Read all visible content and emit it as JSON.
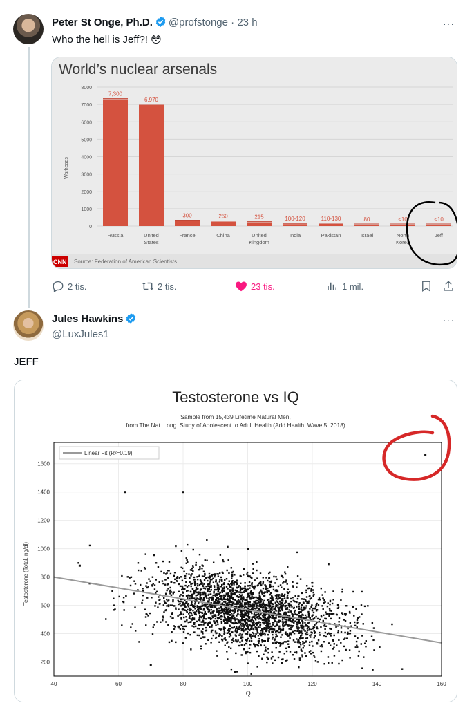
{
  "tweet1": {
    "author_name": "Peter St Onge, Ph.D.",
    "handle": "@profstonge",
    "separator": "·",
    "time": "23 h",
    "text": "Who the hell is Jeff?! 😳",
    "more_label": "···",
    "chart_image": {
      "title": "World’s nuclear arsenals",
      "ylabel": "Warheads",
      "source": "Source: Federation of American Scientists",
      "logo_text": "CNN",
      "annotation": "circle around Jeff"
    },
    "actions": {
      "replies": "2 tis.",
      "reposts": "2 tis.",
      "likes": "23 tis.",
      "views": "1 mil."
    }
  },
  "tweet2": {
    "author_name": "Jules Hawkins",
    "handle": "@LuxJules1",
    "text": "JEFF",
    "more_label": "···",
    "chart_image": {
      "title": "Testosterone vs IQ",
      "subtitle_line1": "Sample from 15,439 Lifetime Natural Men,",
      "subtitle_line2": "from The Nat. Long. Study of Adolescent to Adult Health (Add Health, Wave 5, 2018)",
      "xlabel": "IQ",
      "ylabel": "Testosterone (Total, ng/dl)",
      "legend": "Linear Fit (R²=0.19)",
      "annotation": "red circle around outlier"
    }
  },
  "colors": {
    "bar": "#d4523f",
    "like": "#f91880",
    "verified": "#1d9bf0",
    "muted": "#536471"
  },
  "chart_data": [
    {
      "type": "bar",
      "title": "World’s nuclear arsenals",
      "ylabel": "Warheads",
      "categories": [
        "Russia",
        "United States",
        "France",
        "China",
        "United Kingdom",
        "India",
        "Pakistan",
        "Israel",
        "North Korea",
        "Jeff"
      ],
      "values": [
        7300,
        6970,
        300,
        260,
        215,
        110,
        120,
        80,
        10,
        10
      ],
      "value_labels": [
        "7,300",
        "6,970",
        "300",
        "260",
        "215",
        "100-120",
        "110-130",
        "80",
        "<10",
        "<10"
      ],
      "yticks": [
        "0",
        "1000",
        "2000",
        "3000",
        "4000",
        "5000",
        "6000",
        "7000",
        "8000"
      ],
      "ylim": [
        0,
        8000
      ],
      "grid": true
    },
    {
      "type": "scatter",
      "title": "Testosterone vs IQ",
      "xlabel": "IQ",
      "ylabel": "Testosterone (Total, ng/dl)",
      "xlim": [
        40,
        160
      ],
      "ylim": [
        100,
        1750
      ],
      "xticks": [
        "40",
        "60",
        "80",
        "100",
        "120",
        "140",
        "160"
      ],
      "yticks": [
        "200",
        "400",
        "600",
        "800",
        "1000",
        "1200",
        "1400",
        "1600"
      ],
      "fit_line": {
        "name": "Linear Fit (R²=0.19)",
        "x": [
          40,
          160
        ],
        "y": [
          800,
          335
        ]
      },
      "point_cloud": {
        "center_x": 100,
        "center_y": 560,
        "sd_x": 15,
        "sd_y": 130,
        "n_drawn": 2600
      },
      "outliers": [
        {
          "x": 155,
          "y": 1660
        },
        {
          "x": 62,
          "y": 1400
        },
        {
          "x": 80,
          "y": 1400
        },
        {
          "x": 100,
          "y": 1000
        },
        {
          "x": 48,
          "y": 880
        },
        {
          "x": 70,
          "y": 180
        },
        {
          "x": 96,
          "y": 130
        }
      ],
      "legend_position": "top-left",
      "grid": true
    }
  ]
}
